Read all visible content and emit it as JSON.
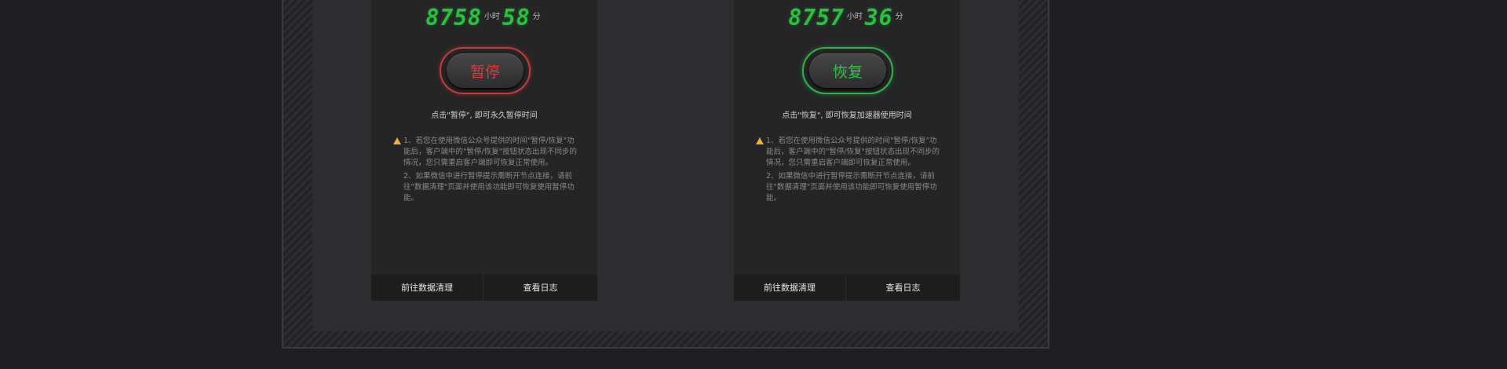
{
  "cards": [
    {
      "hours": "8758",
      "hours_unit": "小时",
      "minutes": "58",
      "minutes_unit": "分",
      "button_label": "暂停",
      "hint": "点击\"暂停\", 即可永久暂停时间",
      "notes": [
        "1、若您在使用微信公众号提供的时间\"暂停/恢复\"功能后，客户端中的\"暂停/恢复\"按钮状态出现不同步的情况，您只需重启客户端即可恢复正常使用。",
        "2、如果微信中进行暂停提示需断开节点连接，请前往\"数据清理\"页面并使用该功能即可恢复使用暂停功能。"
      ],
      "footer": [
        "前往数据清理",
        "查看日志"
      ],
      "accent": "#e0393a"
    },
    {
      "hours": "8757",
      "hours_unit": "小时",
      "minutes": "36",
      "minutes_unit": "分",
      "button_label": "恢复",
      "hint": "点击\"恢复\", 即可恢复加速器使用时间",
      "notes": [
        "1、若您在使用微信公众号提供的时间\"暂停/恢复\"功能后，客户端中的\"暂停/恢复\"按钮状态出现不同步的情况，您只需重启客户端即可恢复正常使用。",
        "2、如果微信中进行暂停提示需断开节点连接，请前往\"数据清理\"页面并使用该功能即可恢复使用暂停功能。"
      ],
      "footer": [
        "前往数据清理",
        "查看日志"
      ],
      "accent": "#31c24c"
    }
  ],
  "colors": {
    "timer_digits": "#28c23f",
    "warning_icon": "#e5b53a"
  },
  "icons": {
    "warning": "warning-triangle-icon"
  }
}
